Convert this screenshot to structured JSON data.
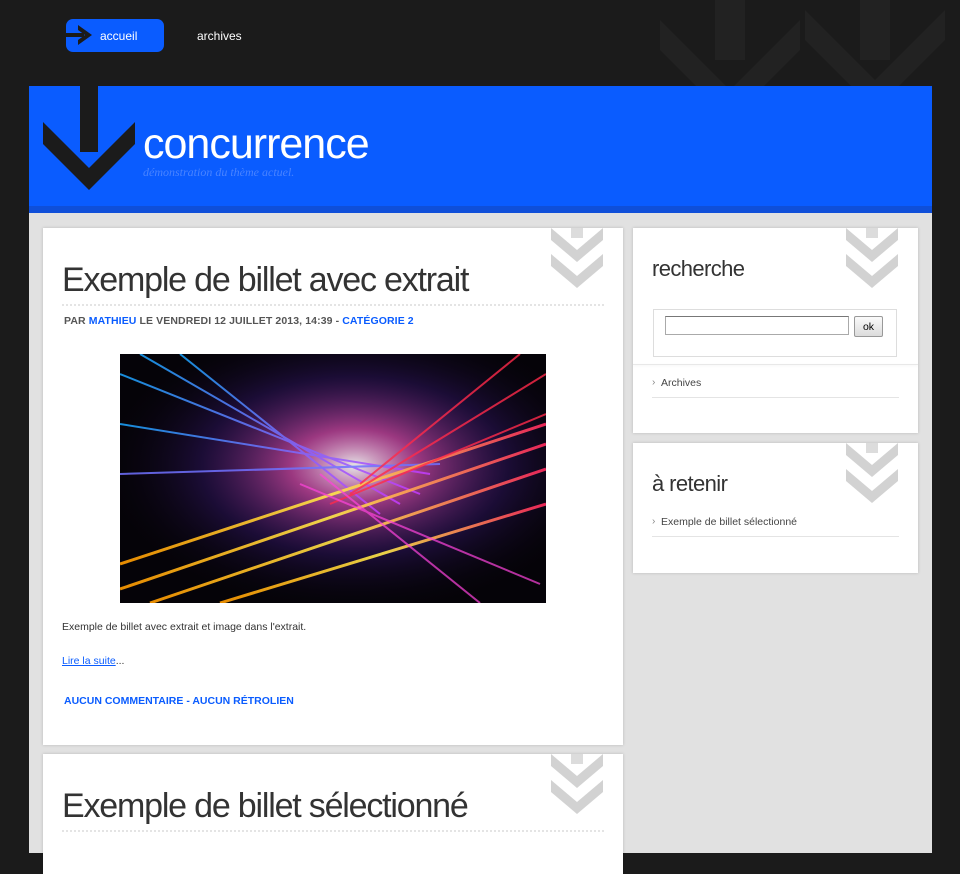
{
  "nav": {
    "items": [
      {
        "label": "accueil",
        "active": true,
        "icon": "arrow-right-icon"
      },
      {
        "label": "archives",
        "active": false
      }
    ]
  },
  "header": {
    "title": "concurrence",
    "description": "démonstration du thème actuel.",
    "icon": "arrow-down-icon"
  },
  "posts": [
    {
      "title": "Exemple de billet avec extrait",
      "meta": {
        "by_label": "Par",
        "author": "Mathieu",
        "date_text": "le vendredi 12 juillet 2013, 14:39",
        "separator": "-",
        "category": "Catégorie 2"
      },
      "image_alt": "abstract colorful light streaks",
      "excerpt": "Exemple de billet avec extrait et image dans l'extrait.",
      "read_more_link": "Lire la suite",
      "read_more_suffix": "...",
      "footer": {
        "comments": "Aucun commentaire",
        "separator": "-",
        "trackbacks": "Aucun rétrolien"
      }
    },
    {
      "title": "Exemple de billet sélectionné"
    }
  ],
  "sidebar": {
    "search": {
      "title": "recherche",
      "input_value": "",
      "button_label": "ok",
      "links": [
        "Archives"
      ]
    },
    "retain": {
      "title": "à retenir",
      "links": [
        "Exemple de billet sélectionné"
      ]
    }
  },
  "colors": {
    "accent": "#0a5cff",
    "background": "#1b1b1b",
    "content_bg": "#e1e1e1",
    "panel": "#ffffff"
  }
}
